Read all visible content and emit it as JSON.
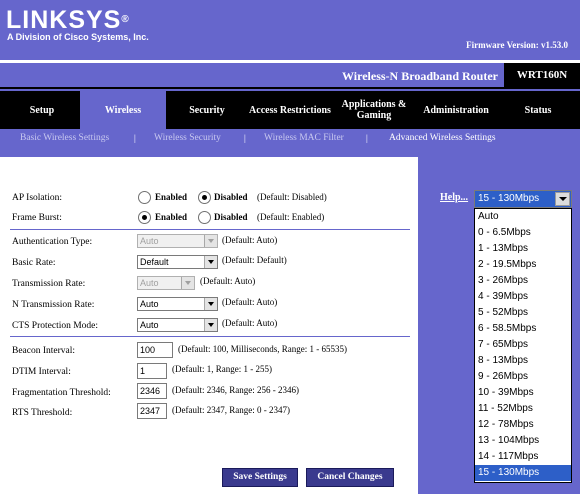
{
  "header": {
    "logo": "LINKSYS",
    "logo_mark": "®",
    "logo_subtitle": "A Division of Cisco Systems, Inc.",
    "firmware": "Firmware Version: v1.53.0",
    "product_name": "Wireless-N Broadband Router",
    "model": "WRT160N"
  },
  "nav": {
    "tabs": [
      "Setup",
      "Wireless",
      "Security",
      "Access Restrictions",
      "Applications & Gaming",
      "Administration",
      "Status"
    ],
    "active": "Wireless"
  },
  "subnav": {
    "items": [
      "Basic Wireless Settings",
      "Wireless Security",
      "Wireless MAC Filter",
      "Advanced Wireless Settings"
    ],
    "separator": "|",
    "active": "Advanced Wireless Settings"
  },
  "form": {
    "ap_isolation": {
      "label": "AP Isolation:",
      "enabled": "Enabled",
      "disabled": "Disabled",
      "selected": "Disabled",
      "note": "(Default: Disabled)"
    },
    "frame_burst": {
      "label": "Frame Burst:",
      "enabled": "Enabled",
      "disabled": "Disabled",
      "selected": "Enabled",
      "note": "(Default: Enabled)"
    },
    "auth_type": {
      "label": "Authentication Type:",
      "value": "Auto",
      "disabled": true,
      "note": "(Default: Auto)"
    },
    "basic_rate": {
      "label": "Basic Rate:",
      "value": "Default",
      "note": "(Default: Default)"
    },
    "transmission_rate": {
      "label": "Transmission Rate:",
      "value": "Auto",
      "disabled": true,
      "note": "(Default: Auto)"
    },
    "n_transmission_rate": {
      "label": "N Transmission Rate:",
      "value": "Auto",
      "note": "(Default: Auto)"
    },
    "cts_protection": {
      "label": "CTS Protection Mode:",
      "value": "Auto",
      "note": "(Default: Auto)"
    },
    "beacon_interval": {
      "label": "Beacon Interval:",
      "value": "100",
      "note": "(Default: 100, Milliseconds, Range: 1 - 65535)"
    },
    "dtim_interval": {
      "label": "DTIM Interval:",
      "value": "1",
      "note": "(Default: 1, Range: 1 - 255)"
    },
    "fragmentation": {
      "label": "Fragmentation Threshold:",
      "value": "2346",
      "note": "(Default: 2346, Range: 256 - 2346)"
    },
    "rts_threshold": {
      "label": "RTS Threshold:",
      "value": "2347",
      "note": "(Default: 2347, Range: 0 - 2347)"
    }
  },
  "buttons": {
    "save": "Save Settings",
    "cancel": "Cancel Changes"
  },
  "help": {
    "label": "Help..."
  },
  "rate_dropdown": {
    "selected": "15 - 130Mbps",
    "options": [
      "Auto",
      "0 - 6.5Mbps",
      "1 - 13Mbps",
      "2 - 19.5Mbps",
      "3 - 26Mbps",
      "4 - 39Mbps",
      "5 - 52Mbps",
      "6 - 58.5Mbps",
      "7 - 65Mbps",
      "8 - 13Mbps",
      "9 - 26Mbps",
      "10 - 39Mbps",
      "11 - 52Mbps",
      "12 - 78Mbps",
      "13 - 104Mbps",
      "14 - 117Mbps",
      "15 - 130Mbps"
    ]
  },
  "colors": {
    "brand": "#6666cc",
    "nav_bg": "#000000",
    "highlight": "#2d5fc8"
  }
}
